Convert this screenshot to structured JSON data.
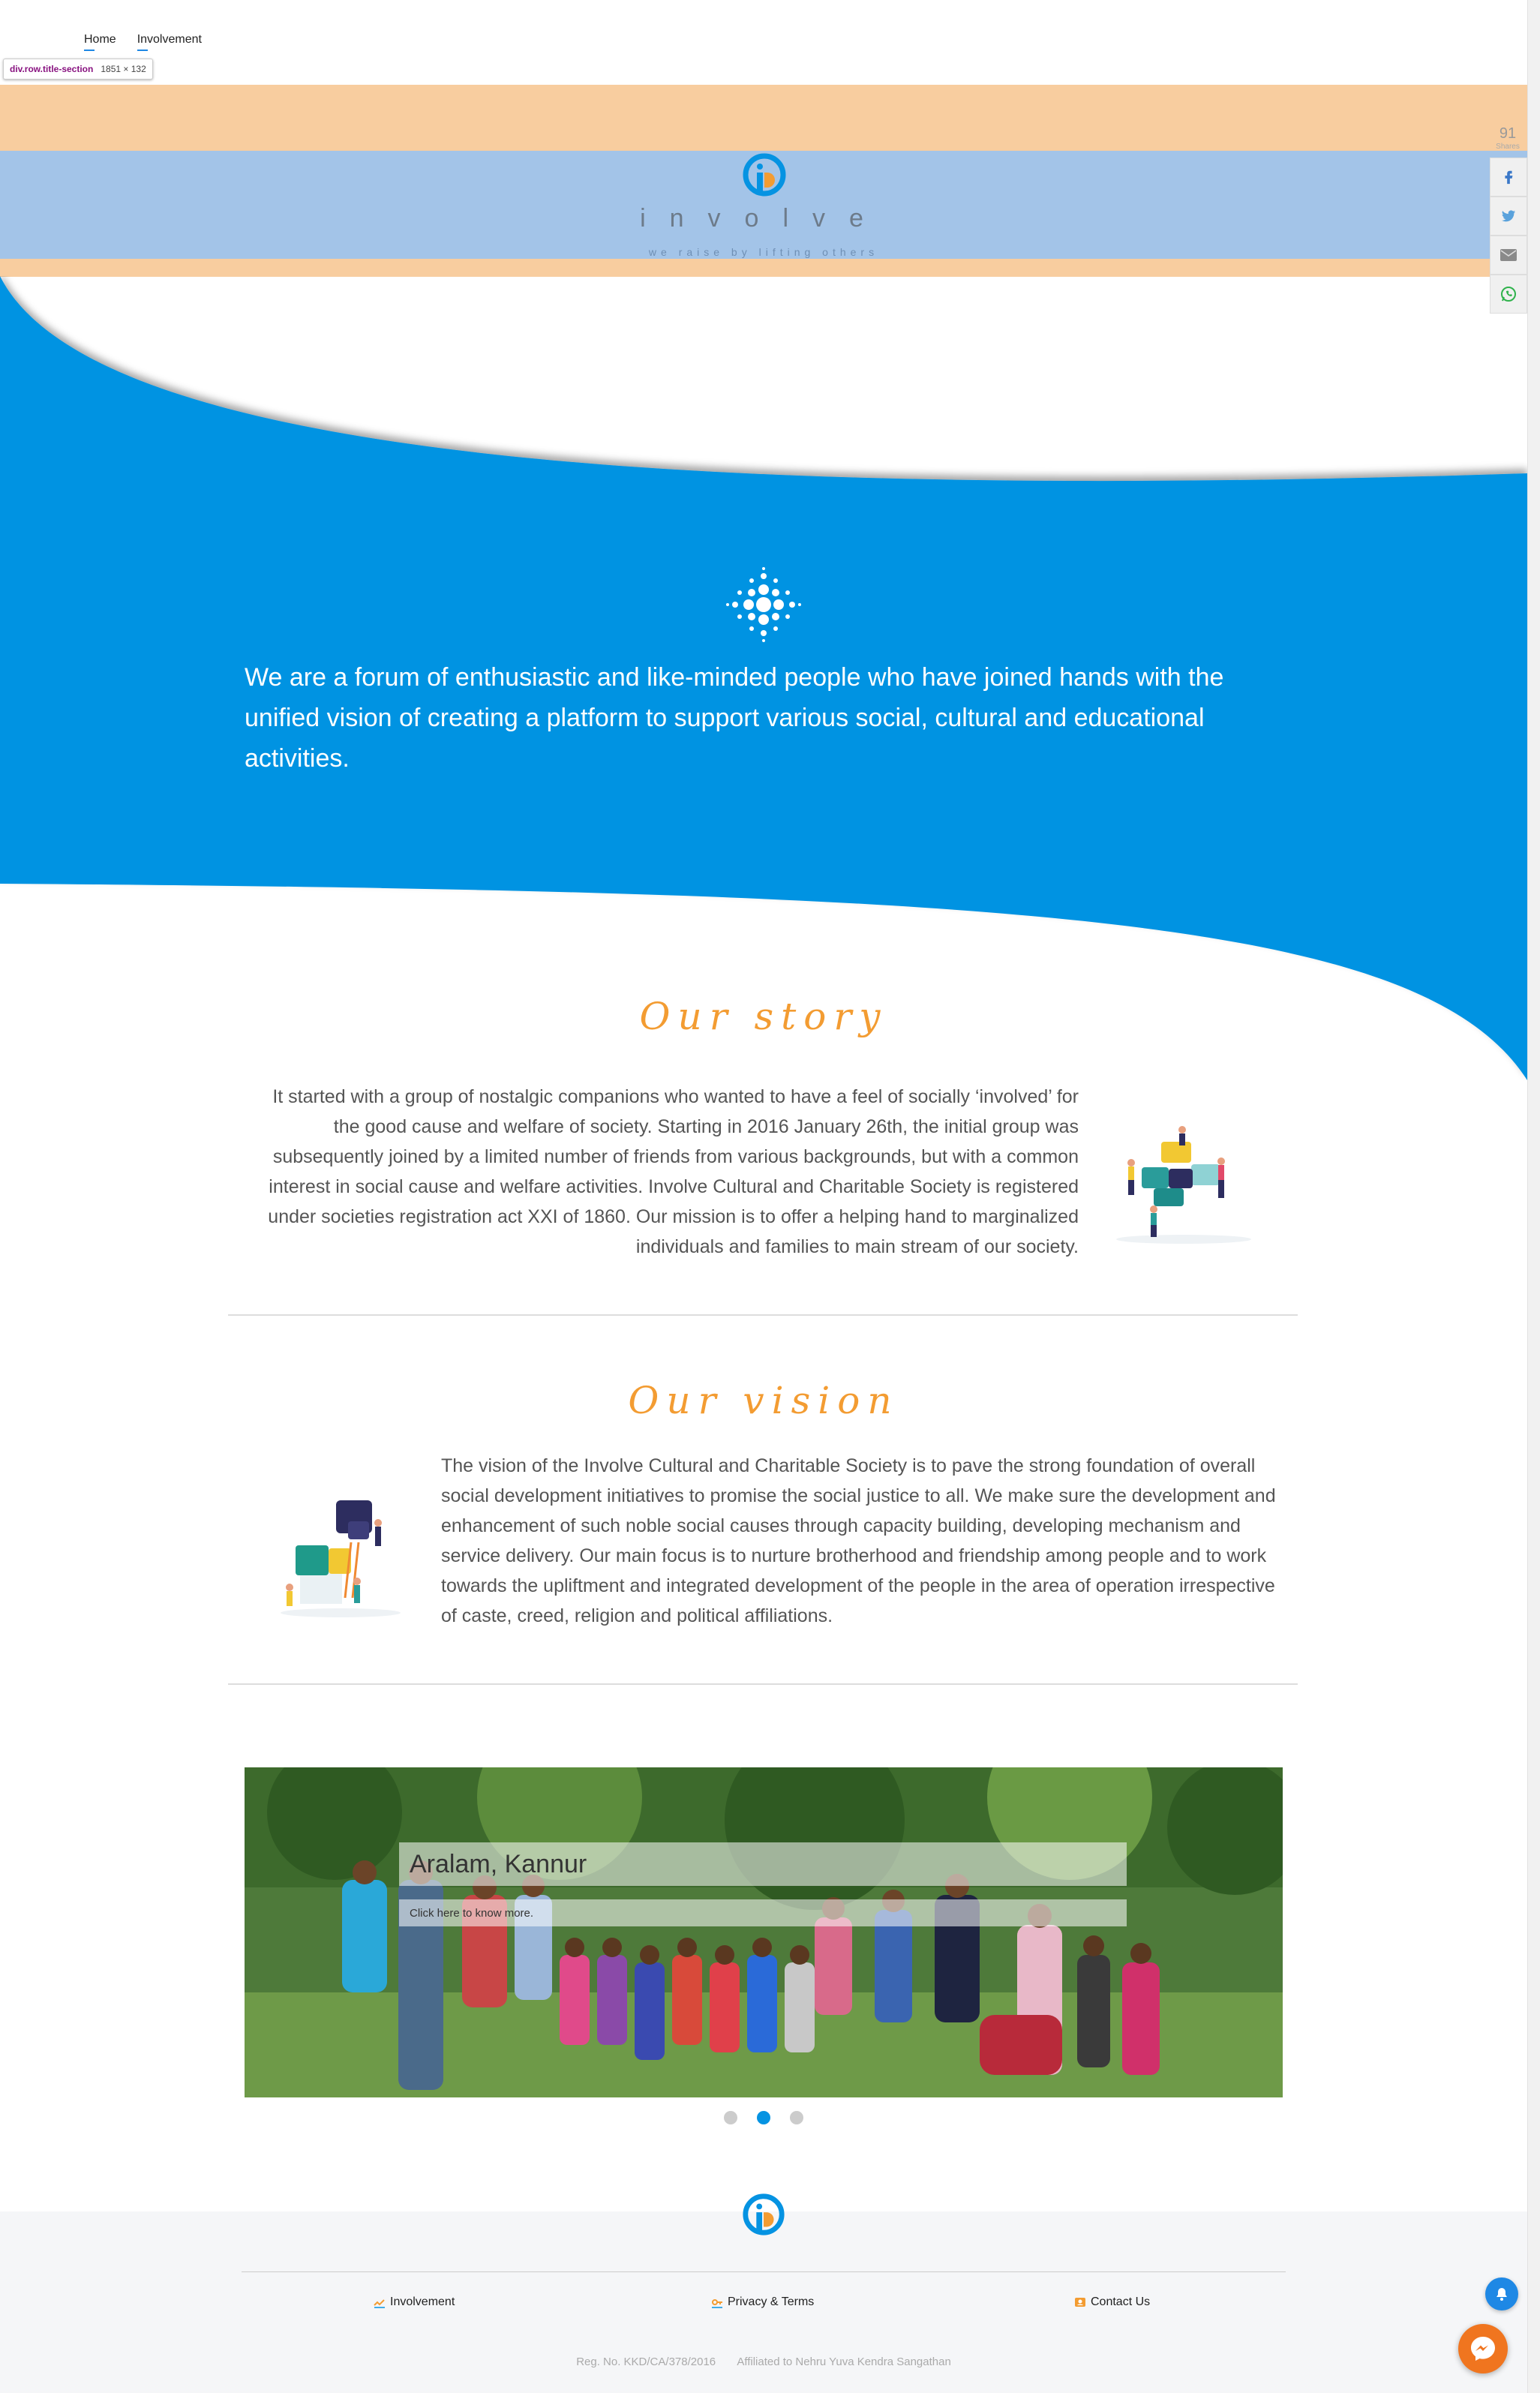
{
  "nav": {
    "items": [
      "Home",
      "Involvement"
    ]
  },
  "inspector_tip": {
    "selector": "div.row.title-section",
    "size": "1851 × 132"
  },
  "header": {
    "brand": "involve",
    "tagline": "we raise by lifting others"
  },
  "share": {
    "count": "91",
    "label": "Shares",
    "buttons": [
      "facebook-icon",
      "twitter-icon",
      "email-icon",
      "whatsapp-icon"
    ]
  },
  "hero": {
    "text": "We are a forum of enthusiastic and like-minded people who have joined hands with the unified vision of creating a platform to support various social, cultural and educational activities."
  },
  "story": {
    "heading": "Our story",
    "text": "It started with a group of nostalgic companions who wanted to have a feel of socially ‘involved’ for the good cause and welfare of society. Starting in 2016 January 26th, the initial group was subsequently joined by a limited number of friends from various backgrounds, but with a common interest in social cause and welfare activities. Involve Cultural and Charitable Society is registered under societies registration act XXI of 1860. Our mission is to offer a helping hand to marginalized individuals and families to main stream of our society."
  },
  "vision": {
    "heading": "Our vision",
    "text": "The vision of the Involve Cultural and Charitable Society is to pave the strong foundation of overall social development initiatives to promise the social justice to all. We make sure the development and enhancement of such noble social causes through capacity building, developing mechanism and service delivery. Our main focus is to nurture brotherhood and friendship among people and to work towards the upliftment and integrated development of the people in the area of operation irrespective of caste, creed, religion and political affiliations."
  },
  "carousel": {
    "title": "Aralam, Kannur",
    "link": "Click here to know more.",
    "dot_count": 3,
    "active_dot": 1
  },
  "footer": {
    "links": [
      "Involvement",
      "Privacy & Terms",
      "Contact Us"
    ],
    "reg": "Reg. No. KKD/CA/378/2016",
    "affiliation": "Affiliated to Nehru Yuva Kendra Sangathan"
  },
  "colors": {
    "blue": "#0593e2",
    "orange": "#f39c32",
    "peach": "#f8cd9f",
    "light_blue": "#a3c4e8"
  }
}
